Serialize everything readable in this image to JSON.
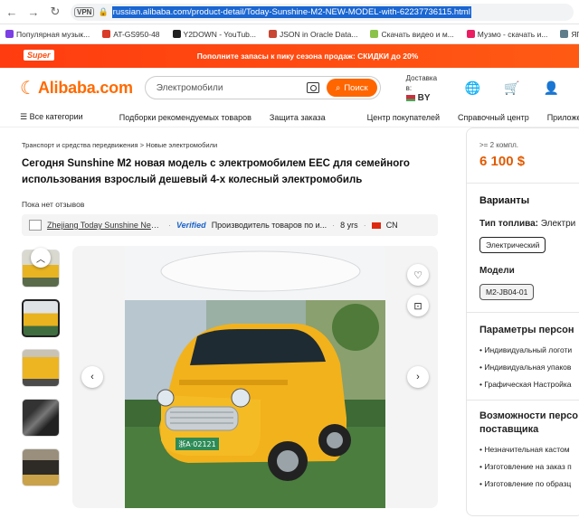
{
  "browser": {
    "vpn": "VPN",
    "url": "russian.alibaba.com/product-detail/Today-Sunshine-M2-NEW-MODEL-with-62237736115.html",
    "bookmarks": [
      {
        "label": "Популярная музык...",
        "color": "#7b3fe4"
      },
      {
        "label": "AT-GS950-48",
        "color": "#d83c2a"
      },
      {
        "label": "Y2DOWN - YouTub...",
        "color": "#222222"
      },
      {
        "label": "JSON in Oracle Data...",
        "color": "#c74634"
      },
      {
        "label": "Скачать видео и м...",
        "color": "#8bc34a"
      },
      {
        "label": "Музмо - скачать и...",
        "color": "#e91e63"
      },
      {
        "label": "ЯПлакаль",
        "color": "#607d8b"
      }
    ]
  },
  "promo": {
    "badge": "Super",
    "text": "Пополните запасы к пику сезона продаж: СКИДКИ до 20%"
  },
  "header": {
    "logo": "Alibaba.com",
    "search_value": "Электромобили",
    "search_button": "Поиск",
    "deliver_label": "Доставка в:",
    "deliver_country": "BY"
  },
  "nav": [
    "Все категории",
    "Подборки рекомендуемых товаров",
    "Защита заказа",
    "Центр покупателей",
    "Справочный центр",
    "Приложение"
  ],
  "product": {
    "breadcrumb": [
      "Транспорт и средства передвижения",
      "Новые электромобили"
    ],
    "title": "Сегодня Sunshine M2 новая модель с электромобилем EEC для семейного использования взрослый дешевый 4-х колесный электромобиль",
    "reviews": "Пока нет отзывов",
    "supplier": {
      "name": "Zhejiang Today Sunshine New Ener...",
      "verified": "Verified",
      "type": "Производитель товаров по и...",
      "years": "8 yrs",
      "country": "CN"
    },
    "plate": "浙A·02121"
  },
  "panel": {
    "moq": ">= 2 компл.",
    "price": "6 100 $",
    "variants_title": "Варианты",
    "fuel_label": "Тип топлива:",
    "fuel_value": "Электри",
    "fuel_chip": "Электрический",
    "models_label": "Модели",
    "model_chip": "M2-JB04-01",
    "params_title": "Параметры персон",
    "params": [
      "Индивидуальный логоти",
      "Индивидуальная упаков",
      "Графическая Настройка"
    ],
    "supplier_title_1": "Возможности персо",
    "supplier_title_2": "поставщика",
    "supplier_items": [
      "Незначительная кастом",
      "Изготовление на заказ п",
      "Изготовление по образц"
    ]
  },
  "colors": {
    "accent": "#ff6a00",
    "price": "#e25a00",
    "verified": "#1b63c9"
  }
}
